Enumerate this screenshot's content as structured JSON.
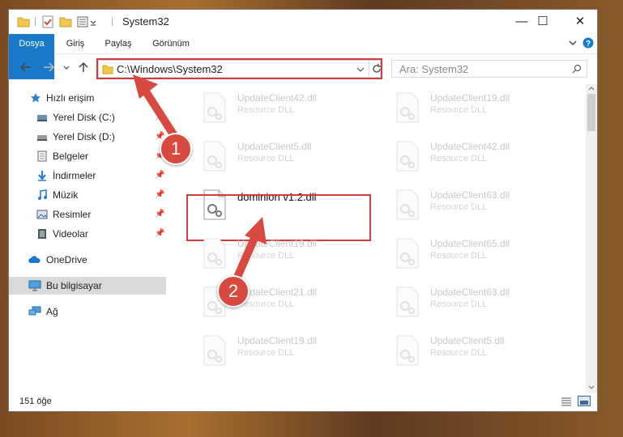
{
  "window": {
    "title": "System32",
    "controls": {
      "minimize": "—",
      "maximize": "☐",
      "close": "✕"
    }
  },
  "ribbon": {
    "tabs": [
      "Dosya",
      "Giriş",
      "Paylaş",
      "Görünüm"
    ]
  },
  "nav": {
    "address": "C:\\Windows\\System32",
    "search_placeholder": "Ara: System32"
  },
  "sidebar": {
    "items": [
      {
        "label": "Hızlı erişim",
        "icon": "star-icon"
      },
      {
        "label": "Yerel Disk (C:)",
        "icon": "drive-icon",
        "pinned": true
      },
      {
        "label": "Yerel Disk (D:)",
        "icon": "drive-icon",
        "pinned": true
      },
      {
        "label": "Belgeler",
        "icon": "document-icon",
        "pinned": true
      },
      {
        "label": "İndirmeler",
        "icon": "download-icon",
        "pinned": true
      },
      {
        "label": "Müzik",
        "icon": "music-icon",
        "pinned": true
      },
      {
        "label": "Resimler",
        "icon": "pictures-icon",
        "pinned": true
      },
      {
        "label": "Videolar",
        "icon": "video-icon",
        "pinned": true
      },
      {
        "label": "OneDrive",
        "icon": "cloud-icon"
      },
      {
        "label": "Bu bilgisayar",
        "icon": "computer-icon",
        "selected": true
      },
      {
        "label": "Ağ",
        "icon": "network-icon"
      }
    ]
  },
  "files": {
    "left": [
      {
        "name": "UpdateClient42.dll",
        "type": "Resource DLL"
      },
      {
        "name": "UpdateClient5.dll",
        "type": "Resource DLL"
      },
      {
        "name": "dominion v1.2.dll",
        "type": "",
        "highlighted": true
      },
      {
        "name": "UpdateClient19.dll",
        "type": "Resource DLL"
      },
      {
        "name": "UpdateClient21.dll",
        "type": "Resource DLL"
      },
      {
        "name": "UpdateClient19.dll",
        "type": "Resource DLL"
      }
    ],
    "right": [
      {
        "name": "UpdateClient19.dll",
        "type": "Resource DLL"
      },
      {
        "name": "UpdateClient42.dll",
        "type": "Resource DLL"
      },
      {
        "name": "UpdateClient63.dll",
        "type": "Resource DLL"
      },
      {
        "name": "UpdateClient65.dll",
        "type": "Resource DLL"
      },
      {
        "name": "UpdateClient63.dll",
        "type": "Resource DLL"
      },
      {
        "name": "UpdateClient5.dll",
        "type": "Resource DLL"
      }
    ]
  },
  "status": {
    "item_count": "151 öğe"
  },
  "callouts": [
    "1",
    "2"
  ],
  "colors": {
    "accent": "#1979ca",
    "callout": "#d84a3f"
  }
}
